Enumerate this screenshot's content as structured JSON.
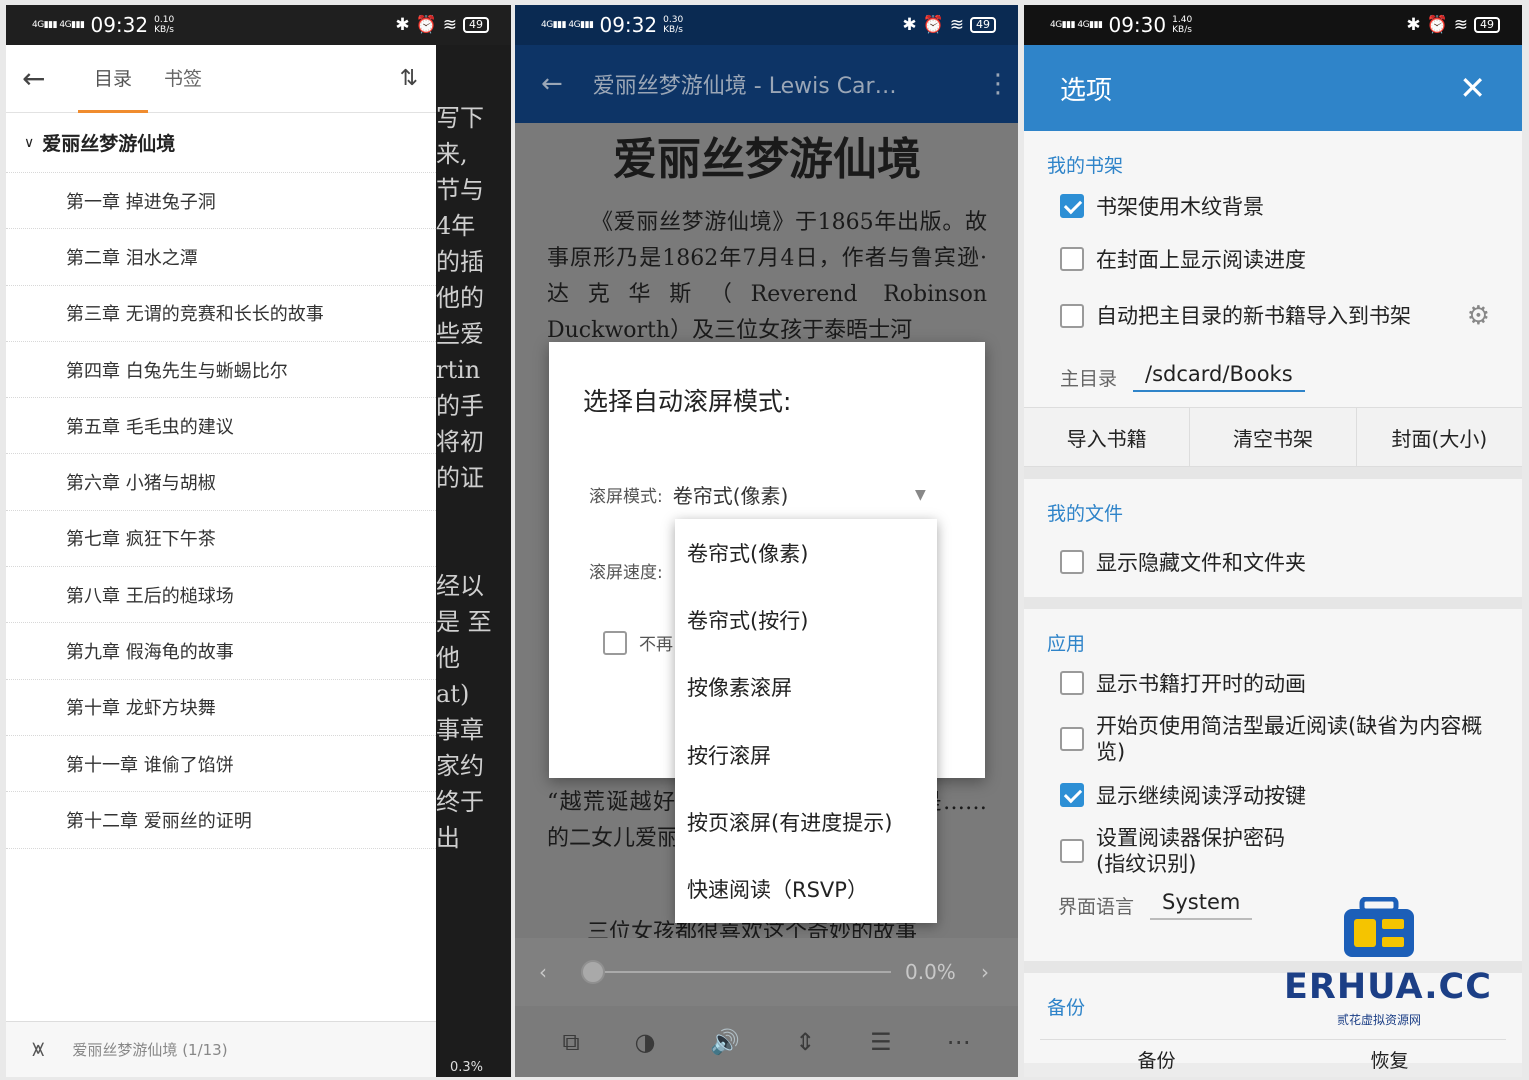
{
  "status_left": {
    "time": "09:32",
    "speed": "0.10\nKB/s",
    "sig": "4G³⁰"
  },
  "status_mid": {
    "time": "09:32",
    "speed": "0.30\nKB/s"
  },
  "status_right": {
    "time": "09:30",
    "speed": "1.40\nKB/s"
  },
  "battery": "49",
  "toc": {
    "tab_contents": "目录",
    "tab_bookmarks": "书签",
    "sort_icon": "sort-icon",
    "root": "爱丽丝梦游仙境",
    "chapters": [
      "第一章 掉进兔子洞",
      "第二章 泪水之潭",
      "第三章 无谓的竞赛和长长的故事",
      "第四章 白兔先生与蜥蜴比尔",
      "第五章 毛毛虫的建议",
      "第六章 小猪与胡椒",
      "第七章 疯狂下午茶",
      "第八章 王后的槌球场",
      "第九章 假海龟的故事",
      "第十章 龙虾方块舞",
      "第十一章 谁偷了馅饼",
      "第十二章 爱丽丝的证明"
    ],
    "footer": "爱丽丝梦游仙境 (1/13)",
    "bg_fragments": [
      "写下",
      "来,",
      "节与",
      "4年",
      "的插",
      "他的",
      "些爱",
      "rtin",
      "的手",
      "将初",
      "的证",
      "",
      "",
      "经以",
      "是 至",
      "他",
      "at)",
      "事章",
      "家约",
      "终于",
      "出"
    ],
    "bg_percent": "0.3%"
  },
  "reader": {
    "title_bar": "爱丽丝梦游仙境 - Lewis Car…",
    "book_title": "爱丽丝梦游仙境",
    "para1": "《爱丽丝梦游仙境》于1865年出版。故事原形乃是1862年7月4日，作者与鲁宾逊·达克华斯（Reverend Robinson Duckworth）及三位女孩于泰晤士河",
    "para_lower": "“越荒诞越好”……故事的主角正好就是……的二女儿爱丽丝……",
    "para_lower2": "三位女孩都很喜欢这个奇妙的故事",
    "dialog_title": "选择自动滚屏模式:",
    "mode_label": "滚屏模式:",
    "mode_value": "卷帘式(像素)",
    "speed_label": "滚屏速度:",
    "dont_show": "不再",
    "menu": [
      "卷帘式(像素)",
      "卷帘式(按行)",
      "按像素滚屏",
      "按行滚屏",
      "按页滚屏(有进度提示)",
      "快速阅读（RSVP）"
    ],
    "progress": "0.0%",
    "progress_value": 0.0
  },
  "options": {
    "title": "选项",
    "sec_shelf": "我的书架",
    "shelf_wood": {
      "label": "书架使用木纹背景",
      "checked": true
    },
    "shelf_progress": {
      "label": "在封面上显示阅读进度",
      "checked": false
    },
    "shelf_import": {
      "label": "自动把主目录的新书籍导入到书架",
      "checked": false
    },
    "home_dir_label": "主目录",
    "home_dir_value": "/sdcard/Books",
    "btn_import": "导入书籍",
    "btn_clear": "清空书架",
    "btn_cover": "封面(大小)",
    "sec_files": "我的文件",
    "show_hidden": {
      "label": "显示隐藏文件和文件夹",
      "checked": false
    },
    "sec_app": "应用",
    "anim": {
      "label": "显示书籍打开时的动画",
      "checked": false
    },
    "simple_recent": {
      "label": "开始页使用简洁型最近阅读(缺省为内容概览)",
      "checked": false
    },
    "float_btn": {
      "label": "显示继续阅读浮动按键",
      "checked": true
    },
    "password": {
      "label": "设置阅读器保护密码(指纹识别)",
      "checked": false
    },
    "lang_label": "界面语言",
    "lang_value": "System",
    "sec_backup": "备份",
    "backup_btn": "备份",
    "restore_btn": "恢复"
  },
  "watermark": {
    "brand": "ERHUA.CC",
    "sub": "贰花虚拟资源网"
  },
  "colors": {
    "accent_orange": "#f08c2f",
    "accent_blue": "#2f84c9",
    "toolbar_navy": "#0d3466"
  }
}
